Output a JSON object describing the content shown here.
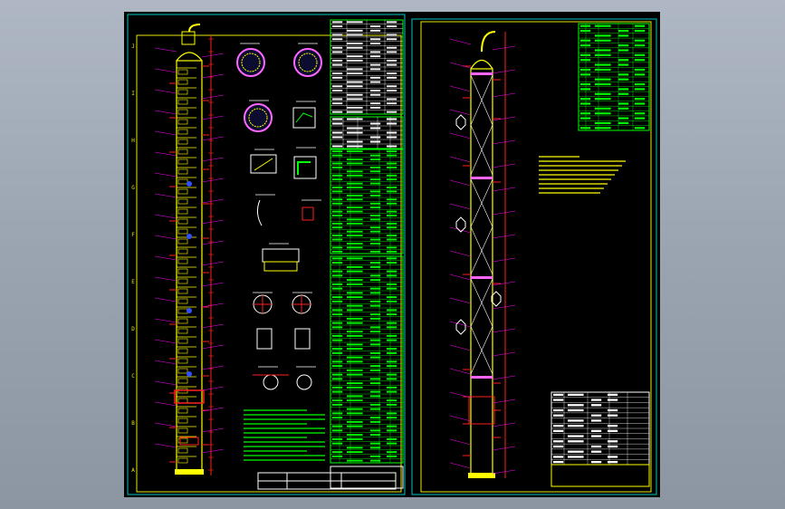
{
  "viewport": {
    "title": ""
  },
  "colors": {
    "background": "#9aa4b0",
    "sheet": "#000000",
    "frame": "#e8e800",
    "vessel": "#ffff00",
    "table_line": "#00ff00",
    "dimension": "#ff2020",
    "leader": "#ff00ff",
    "outline": "#ffffff",
    "frame_border": "#00c8c8"
  },
  "left_sheet": {
    "row_markers": [
      "J",
      "I",
      "H",
      "G",
      "F",
      "E",
      "D",
      "C",
      "B",
      "A"
    ]
  },
  "right_sheet": {
    "notes_label": "",
    "title_block": ""
  }
}
